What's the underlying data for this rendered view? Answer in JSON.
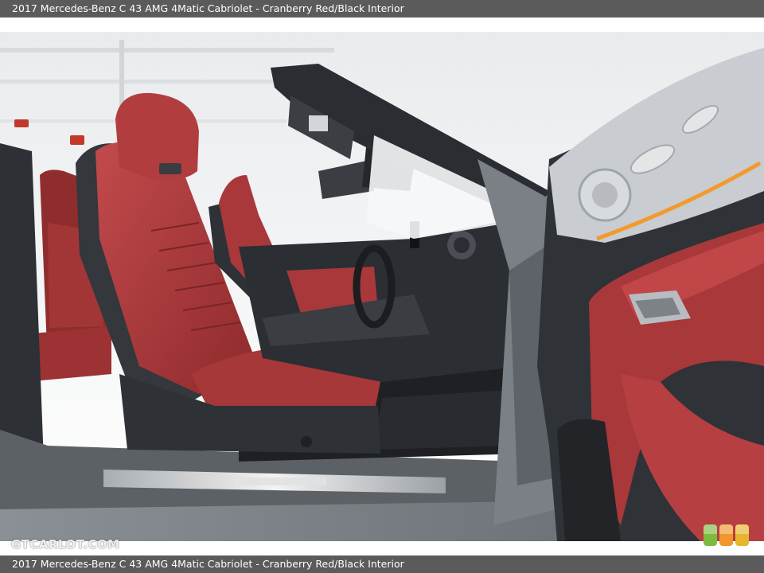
{
  "caption": {
    "top": "2017 Mercedes-Benz C 43 AMG 4Matic Cabriolet - Cranberry Red/Black Interior",
    "bottom": "2017 Mercedes-Benz C 43 AMG 4Matic Cabriolet - Cranberry Red/Black Interior"
  },
  "photo": {
    "subject": "",
    "colors": {
      "leather_red": "#a8383a",
      "leather_dark": "#7a2425",
      "black_trim": "#2e3136",
      "body_gray": "#7b8186",
      "ceiling": "#f2f3f4"
    }
  },
  "watermark": {
    "text": "GTCARLOT.COM"
  },
  "swatches": [
    {
      "name": "green",
      "color": "#7dbb3c"
    },
    {
      "name": "orange",
      "color": "#f0962a"
    },
    {
      "name": "yellow",
      "color": "#e7b52c"
    }
  ]
}
